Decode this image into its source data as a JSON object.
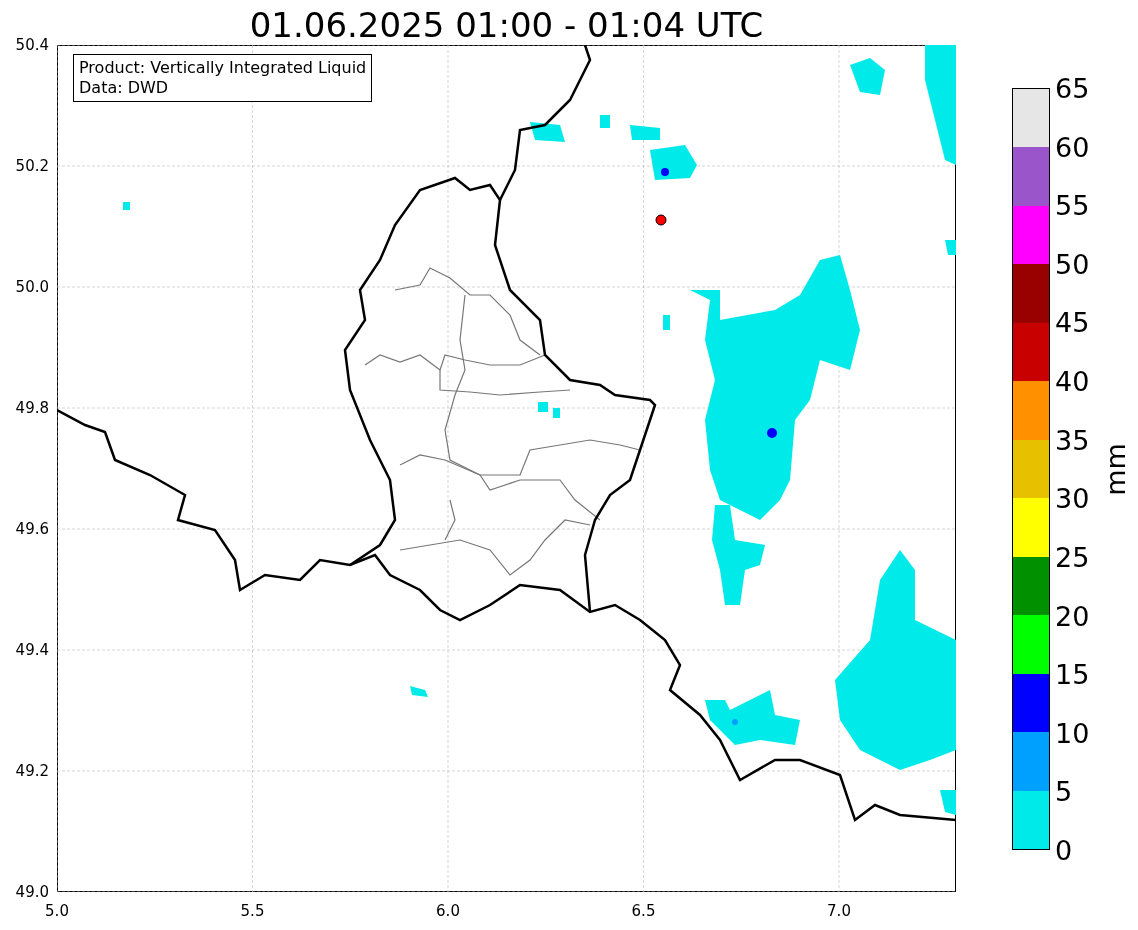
{
  "title": "01.06.2025 01:00 - 01:04 UTC",
  "info_box": {
    "lines": [
      "Product: Vertically Integrated Liquid",
      "Data: DWD"
    ]
  },
  "y_axis": {
    "ticks": [
      "50.4",
      "50.2",
      "50.0",
      "49.8",
      "49.6",
      "49.4",
      "49.2",
      "49.0"
    ]
  },
  "x_axis": {
    "ticks": [
      "5.0",
      "5.5",
      "6.0",
      "6.5",
      "7.0"
    ]
  },
  "colorbar": {
    "label": "mm",
    "ticks": [
      "65",
      "60",
      "55",
      "50",
      "45",
      "40",
      "35",
      "30",
      "25",
      "20",
      "15",
      "10",
      "5",
      "0"
    ],
    "bins": [
      {
        "color": "#e6e6e6"
      },
      {
        "color": "#9955c9"
      },
      {
        "color": "#ff00ff"
      },
      {
        "color": "#990000"
      },
      {
        "color": "#c80000"
      },
      {
        "color": "#ff9000"
      },
      {
        "color": "#e7c000"
      },
      {
        "color": "#ffff00"
      },
      {
        "color": "#009000"
      },
      {
        "color": "#00ff00"
      },
      {
        "color": "#0000ff"
      },
      {
        "color": "#00a0ff"
      },
      {
        "color": "#00eaea"
      }
    ]
  }
}
